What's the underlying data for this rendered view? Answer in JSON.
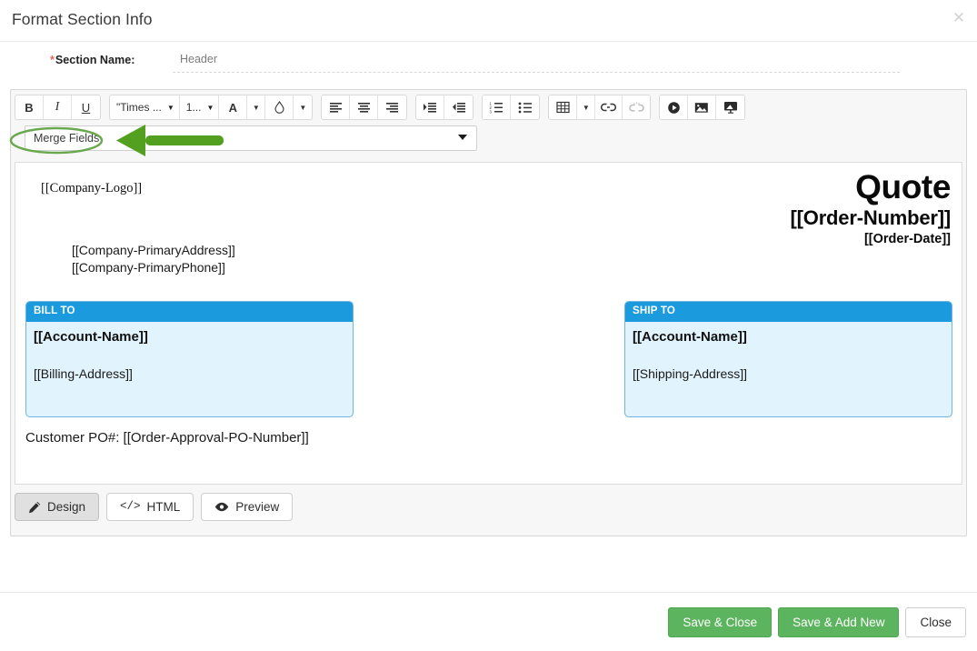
{
  "modal": {
    "title": "Format Section Info",
    "close_icon": "close-x-icon"
  },
  "form": {
    "section_name_label": "Section Name:",
    "required_marker": "*",
    "section_name_value": "Header"
  },
  "toolbar": {
    "bold": "B",
    "italic": "I",
    "underline": "U",
    "font_family": "\"Times ...",
    "font_size": "1...",
    "text_color": "A",
    "highlight_color": "highlight-droplet-icon",
    "align_left": "align-left-icon",
    "align_center": "align-center-icon",
    "align_right": "align-right-icon",
    "indent": "indent-increase-icon",
    "outdent": "indent-decrease-icon",
    "ordered_list": "ordered-list-icon",
    "unordered_list": "bullet-list-icon",
    "table": "table-icon",
    "link": "link-icon",
    "unlink": "unlink-icon",
    "video": "video-play-icon",
    "image": "image-icon",
    "slideshow": "presentation-icon"
  },
  "merge_fields": {
    "label": "Merge Fields",
    "caret_icon": "chevron-down-icon"
  },
  "document": {
    "company_logo": "[[Company-Logo]]",
    "quote_title": "Quote",
    "order_number": "[[Order-Number]]",
    "order_date": "[[Order-Date]]",
    "company_address": "[[Company-PrimaryAddress]]",
    "company_phone": "[[Company-PrimaryPhone]]",
    "bill_to": {
      "heading": "BILL TO",
      "account_name": "[[Account-Name]]",
      "address": "[[Billing-Address]]"
    },
    "ship_to": {
      "heading": "SHIP TO",
      "account_name": "[[Account-Name]]",
      "address": "[[Shipping-Address]]"
    },
    "po_line": "Customer PO#: [[Order-Approval-PO-Number]]"
  },
  "mode_tabs": [
    {
      "label": "Design",
      "icon": "pencil-icon",
      "active": true
    },
    {
      "label": "HTML",
      "icon": "code-icon",
      "active": false
    },
    {
      "label": "Preview",
      "icon": "eye-icon",
      "active": false
    }
  ],
  "footer": {
    "save_close": "Save & Close",
    "save_add_new": "Save & Add New",
    "close": "Close"
  },
  "colors": {
    "green_button": "#5cb45f",
    "annotation_green": "#6aa84f",
    "box_header_blue": "#1b9bde",
    "box_body_blue": "#e1f3fc",
    "required_red": "#e8665a"
  }
}
